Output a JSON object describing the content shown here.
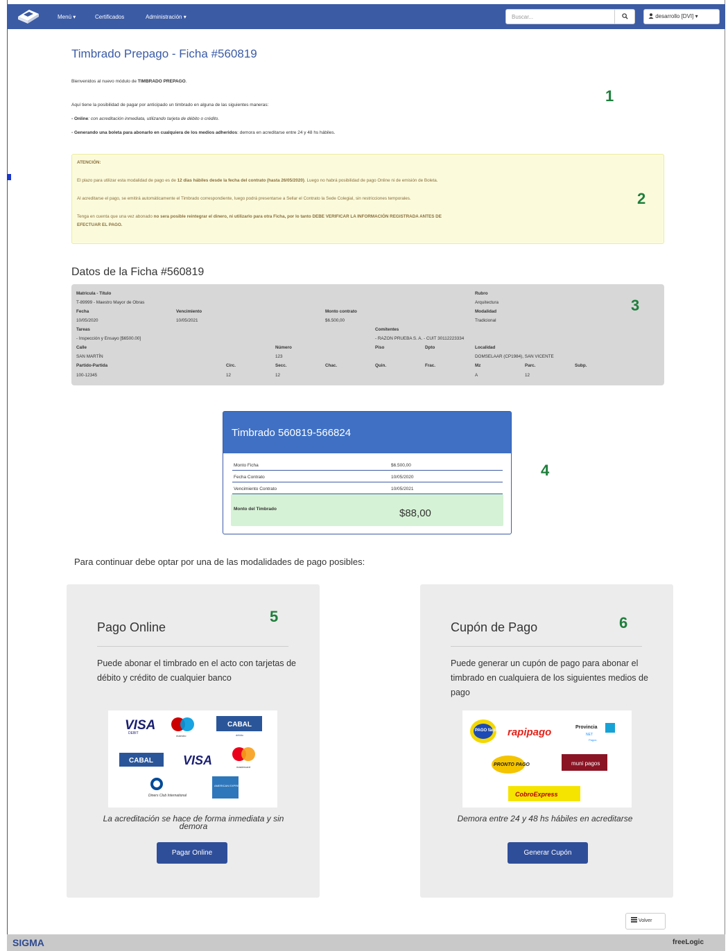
{
  "navbar": {
    "menu": "Menú ▾",
    "certificados": "Certificados",
    "administracion": "Administración ▾",
    "search_placeholder": "Buscar...",
    "search_icon": "magnifier-icon",
    "user": "desarrollo [DVI] ▾"
  },
  "page": {
    "title": "Timbrado Prepago - Ficha #560819",
    "intro_prefix": "Bienvenidos al nuevo módulo de ",
    "intro_strong": "TIMBRADO PREPAGO",
    "intro_suffix": ".",
    "ways": "Aquí tiene la posibilidad de pagar por anticipado un timbrado en alguna de las siguientes maneras:",
    "online_strong": "- Online",
    "online_text": ": con acreditación inmediata, utilizando tarjeta de débito o crédito.",
    "boleta_strong": "- Generando una boleta para abonarlo en cualquiera de los medios adheridos",
    "boleta_text": ": demora en acreditarse entre 24 y 48 hs hábiles.",
    "markers": [
      "1",
      "2",
      "3",
      "4",
      "5",
      "6"
    ]
  },
  "alert": {
    "title": "ATENCIÓN:",
    "p1_a": "El plazo para utilizar esta modalidad de pago es de ",
    "p1_b": "12 días hábiles desde la fecha del contrato (hasta 26/05/2020)",
    "p1_c": ". Luego no habrá posibilidad de pago Online ni de emisión de Boleta.",
    "p2": "Al acreditarse el pago, se emitirá automáticamente el Timbrado correspondiente, luego podrá presentarse a Sellar el Contrato la Sede Colegial, sin restricciones temporales.",
    "p3_a": "Tenga en cuenta que una vez abonado ",
    "p3_b": "no sera posible reintegrar el dinero, ni utilizarlo para otra Ficha, por lo tanto DEBE VERIFICAR LA INFORMACIÓN REGISTRADA ANTES DE",
    "p3_c": "EFECTUAR EL PAGO."
  },
  "datos": {
    "heading": "Datos de la Ficha #560819",
    "matricula_label": "Matricula - Título",
    "matricula": "T-89999 - Maestro Mayor de Obras",
    "rubro_label": "Rubro",
    "rubro": "Arquitectura",
    "fecha_label": "Fecha",
    "fecha": "10/05/2020",
    "venc_label": "Vencimiento",
    "venc": "10/05/2021",
    "monto_label": "Monto contrato",
    "monto": "$6.500,00",
    "modalidad_label": "Modalidad",
    "modalidad": "Tradicional",
    "tareas_label": "Tareas",
    "tareas": "- Inspección y Ensayo [$6500.00]",
    "comitentes_label": "Comitentes",
    "comitentes": "- RAZON PRUEBA S. A. - CUIT 30112223334",
    "calle_label": "Calle",
    "calle": "SAN MARTÍN",
    "numero_label": "Número",
    "numero": "123",
    "piso_label": "Piso",
    "dpto_label": "Dpto",
    "localidad_label": "Localidad",
    "localidad": "DOMSELAAR (CP1984), SAN VICENTE",
    "partido_label": "Partido-Partida",
    "partido": "100-12345",
    "circ_label": "Circ.",
    "circ": "12",
    "secc_label": "Secc.",
    "secc": "12",
    "chac_label": "Chac.",
    "quin_label": "Quin.",
    "frac_label": "Frac.",
    "mz_label": "Mz",
    "mz": "A",
    "parc_label": "Parc.",
    "parc": "12",
    "subp_label": "Subp."
  },
  "timbrado": {
    "title": "Timbrado 560819-566824",
    "rows": [
      {
        "label": "Monto Ficha",
        "value": "$6.500,00"
      },
      {
        "label": "Fecha Contrato",
        "value": "10/05/2020"
      },
      {
        "label": "Vencimiento Contrato",
        "value": "10/05/2021"
      }
    ],
    "monto_label": "Monto del Timbrado",
    "monto_value": "$88,00"
  },
  "continuar": "Para continuar debe optar por una de las modalidades de pago posibles:",
  "online": {
    "title": "Pago Online",
    "desc": "Puede abonar el timbrado en el acto con tarjetas de débito y crédito de cualquier banco",
    "logos": [
      "VISA",
      "DEBIT",
      "maestro",
      "CABAL",
      "débito",
      "CABAL",
      "VISA",
      "mastercard",
      "Diners Club International",
      "AMERICAN EXPRESS"
    ],
    "note": "La acreditación se hace de forma inmediata y sin demora",
    "button": "Pagar Online"
  },
  "cupon": {
    "title": "Cupón de Pago",
    "desc": "Puede generar un cupón de pago para abonar el timbrado en cualquiera de los siguientes medios de pago",
    "logos": [
      "PAGO fácil",
      "rapipago",
      "Provincia",
      "NET",
      "Pagos",
      "PRONTO PAGO",
      "muni pagos",
      "CobroExpress"
    ],
    "note": "Demora entre 24 y 48 hs hábiles en acreditarse",
    "button": "Generar Cupón"
  },
  "volver": "Volver",
  "footer": {
    "left": "SIGMA",
    "right": "freeLogic"
  },
  "colors": {
    "navbar": "#3b5ba5",
    "card_header": "#3f70c4",
    "button": "#2f4e9a",
    "marker": "#1e7f3c",
    "success": "#d6f2d6",
    "warning": "#fbfbdc"
  }
}
